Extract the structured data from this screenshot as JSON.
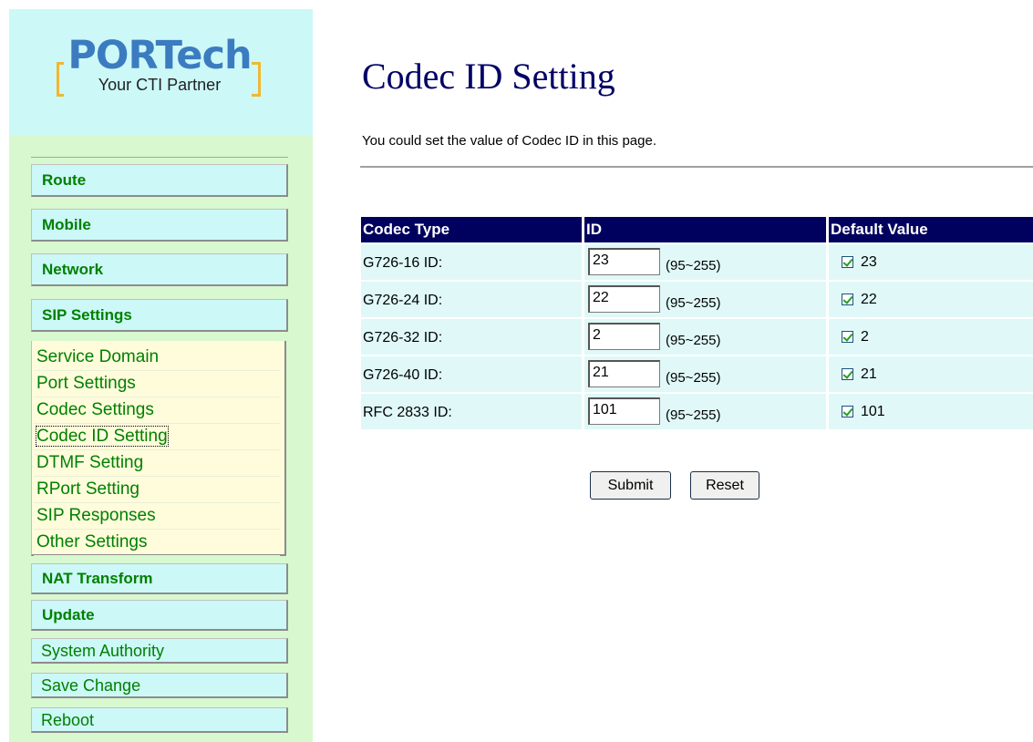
{
  "logo": {
    "name": "PORTech",
    "tagline": "Your CTI Partner"
  },
  "sidebar": {
    "main_items": [
      {
        "label": "Route"
      },
      {
        "label": "Mobile"
      },
      {
        "label": "Network"
      },
      {
        "label": "SIP Settings"
      }
    ],
    "sip_submenu": [
      {
        "label": "Service Domain"
      },
      {
        "label": "Port Settings"
      },
      {
        "label": "Codec Settings"
      },
      {
        "label": "Codec ID Setting",
        "active": true
      },
      {
        "label": "DTMF Setting"
      },
      {
        "label": "RPort Setting"
      },
      {
        "label": "SIP Responses"
      },
      {
        "label": "Other Settings"
      }
    ],
    "lower_items": [
      {
        "label": "NAT Transform"
      },
      {
        "label": "Update"
      }
    ],
    "system_items": [
      {
        "label": "System Authority"
      },
      {
        "label": "Save Change"
      },
      {
        "label": "Reboot"
      }
    ]
  },
  "page": {
    "title": "Codec ID Setting",
    "description": "You could set the value of Codec ID in this page."
  },
  "table": {
    "headers": [
      "Codec Type",
      "ID",
      "Default Value"
    ],
    "rows": [
      {
        "type": "G726-16 ID:",
        "id": "23",
        "range": "(95~255)",
        "default": "23",
        "checked": true
      },
      {
        "type": "G726-24 ID:",
        "id": "22",
        "range": "(95~255)",
        "default": "22",
        "checked": true
      },
      {
        "type": "G726-32 ID:",
        "id": "2",
        "range": "(95~255)",
        "default": "2",
        "checked": true
      },
      {
        "type": "G726-40 ID:",
        "id": "21",
        "range": "(95~255)",
        "default": "21",
        "checked": true
      },
      {
        "type": "RFC 2833 ID:",
        "id": "101",
        "range": "(95~255)",
        "default": "101",
        "checked": true
      }
    ]
  },
  "buttons": {
    "submit": "Submit",
    "reset": "Reset"
  },
  "colors": {
    "sidebar_bg": "#d8f8d0",
    "logo_bg": "#ccf8f8",
    "nav_text": "#008000",
    "submenu_bg": "#fffcdc",
    "table_header_bg": "#00005e",
    "table_cell_bg": "#e0f8f8",
    "title_color": "#000066"
  }
}
